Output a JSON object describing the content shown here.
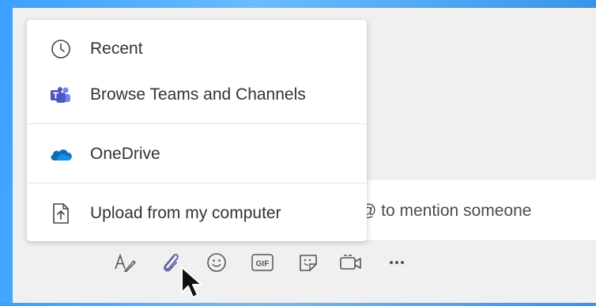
{
  "menu": {
    "items": [
      {
        "label": "Recent",
        "icon": "clock-icon"
      },
      {
        "label": "Browse Teams and Channels",
        "icon": "teams-icon"
      },
      {
        "label": "OneDrive",
        "icon": "onedrive-icon"
      },
      {
        "label": "Upload from my computer",
        "icon": "upload-icon"
      }
    ]
  },
  "compose": {
    "placeholder": "@ to mention someone"
  },
  "toolbar": {
    "items": [
      "format-icon",
      "attach-icon",
      "emoji-icon",
      "gif-icon",
      "sticker-icon",
      "meet-icon",
      "more-icon"
    ],
    "gif_label": "GIF"
  },
  "colors": {
    "accent": "#6264a7",
    "onedrive": "#0f6cbd",
    "background": "#f0f0f0"
  }
}
